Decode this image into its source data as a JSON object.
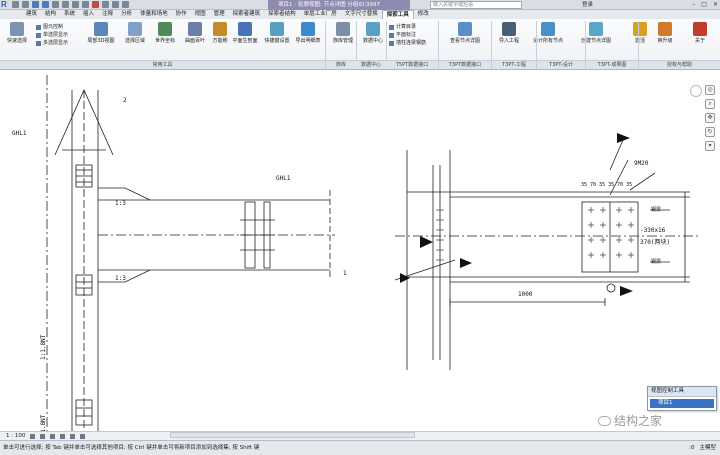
{
  "titlebar": {
    "window_title": "项目1 - 轮廓视图: 节点详图 分组ID:3997",
    "search_placeholder": "键入关键字或短语",
    "user": "登录"
  },
  "tabs": [
    "建筑",
    "结构",
    "系统",
    "插入",
    "注释",
    "分析",
    "体量和场地",
    "协作",
    "视图",
    "管理",
    "探索者建筑",
    "探索者结构",
    "单层工业厂房",
    "文字尺寸替换",
    "探索工具",
    "修改"
  ],
  "active_tab": "探索工具",
  "ribbon": {
    "quick_select": "快速选择",
    "small_items": [
      "图元控制",
      "单选层显示",
      "多选层显示"
    ],
    "buttons": [
      "局部3D视图",
      "选择区域",
      "世界坐标",
      "曲面百叶",
      "万能刷",
      "平面生剖面",
      "快捷键设置",
      "导出明细表",
      "族库管理",
      "数据中心"
    ],
    "t5pt_items": [
      "计算目录",
      "平面标注",
      "墙柱连梁钢筋"
    ],
    "more_buttons": [
      "查看节点详图",
      "导入工程",
      "设计所有节点",
      "创建节点详图",
      "激活",
      "换升级",
      "关于"
    ],
    "panels": [
      "常用工具",
      "族库",
      "数据中心",
      "T5PT数据接口",
      "T3PT数据接口",
      "T3PT-工程",
      "T3PT-设计",
      "T3PT-成果图",
      "授权与帮助"
    ]
  },
  "drawing": {
    "labels": {
      "grid2": "2",
      "grid1": "1",
      "ghl1_left": "GHL1",
      "ghl1_mid": "GHL1",
      "slope1": "1:3",
      "slope2": "1:3",
      "col_text1": "1:1.8NT",
      "col_text2": "1:1.8NT",
      "bolt_spec": "9M20",
      "dims_top": "35 70 35 35 70 35",
      "plate_spec": "-330x16",
      "plate_len": "370(两块)",
      "dim_1000": "1000",
      "side_label": "钢梁",
      "side_label2": "钢梁"
    }
  },
  "popup": {
    "header": "视图控制工具",
    "item": "项目1"
  },
  "watermark": "结构之家",
  "viewbar": {
    "scale": "1 : 100"
  },
  "statusbar": {
    "message": "单击可进行选择; 按 Tab 键并单击可选择其他项目; 按 Ctrl 键并单击可将新项目添加到选择集; 按 Shift 键",
    "zero": ":0",
    "model": "主模型"
  },
  "colors": {
    "accent": "#3a73c5",
    "title_bg": "#8e8ab0"
  }
}
